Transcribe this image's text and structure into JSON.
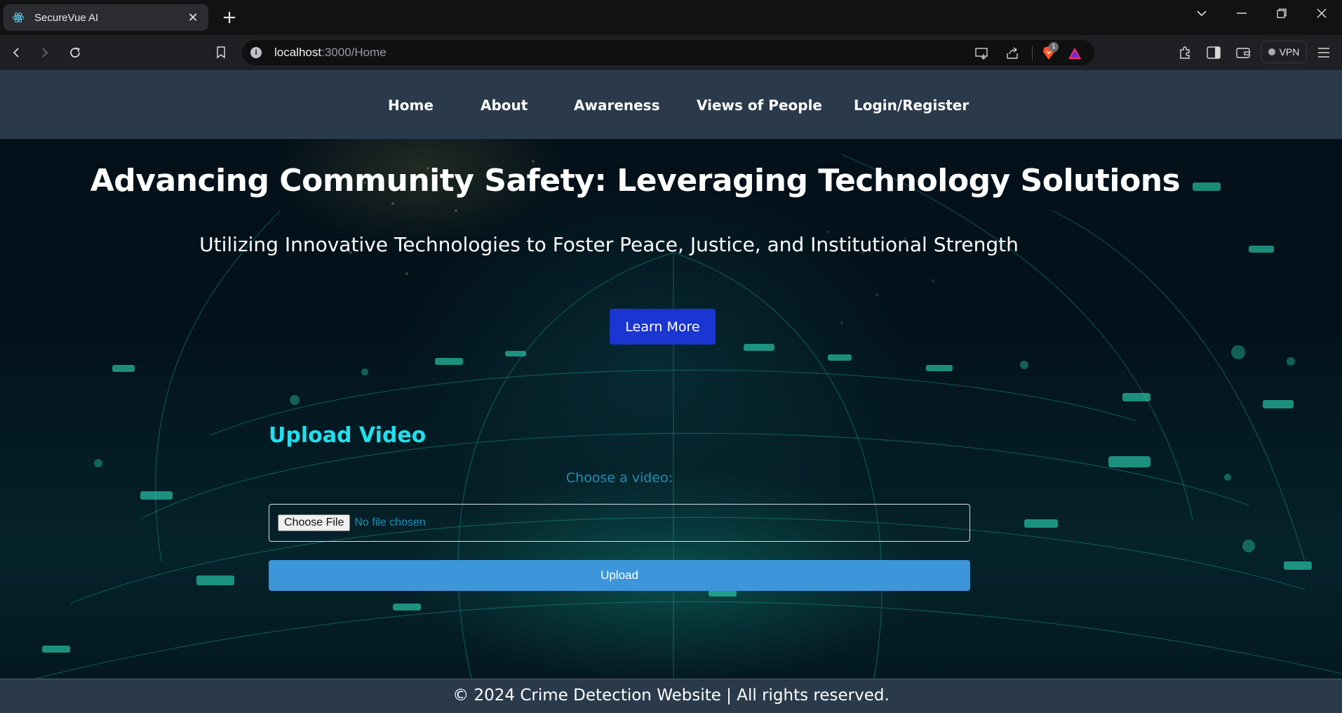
{
  "browser": {
    "tab_title": "SecureVue AI",
    "new_tab_label": "+",
    "url_host": "localhost",
    "url_path": ":3000/Home",
    "vpn_label": "VPN",
    "shields_badge": "1"
  },
  "navbar": {
    "items": [
      "Home",
      "About",
      "Awareness",
      "Views of People",
      "Login/Register"
    ]
  },
  "hero": {
    "title": "Advancing Community Safety: Leveraging Technology Solutions",
    "subtitle": "Utilizing Innovative Technologies to Foster Peace, Justice, and Institutional Strength",
    "cta_label": "Learn More"
  },
  "upload": {
    "title": "Upload Video",
    "choose_label": "Choose a video:",
    "file_button": "Choose File",
    "file_status": "No file chosen",
    "submit_label": "Upload"
  },
  "footer": {
    "text": "© 2024 Crime Detection Website | All rights reserved."
  },
  "colors": {
    "navbar_bg": "#2b3a4b",
    "accent_cyan": "#1fe0ee",
    "learn_more_bg": "#1a35d2",
    "upload_btn_bg": "#3c96d9"
  }
}
